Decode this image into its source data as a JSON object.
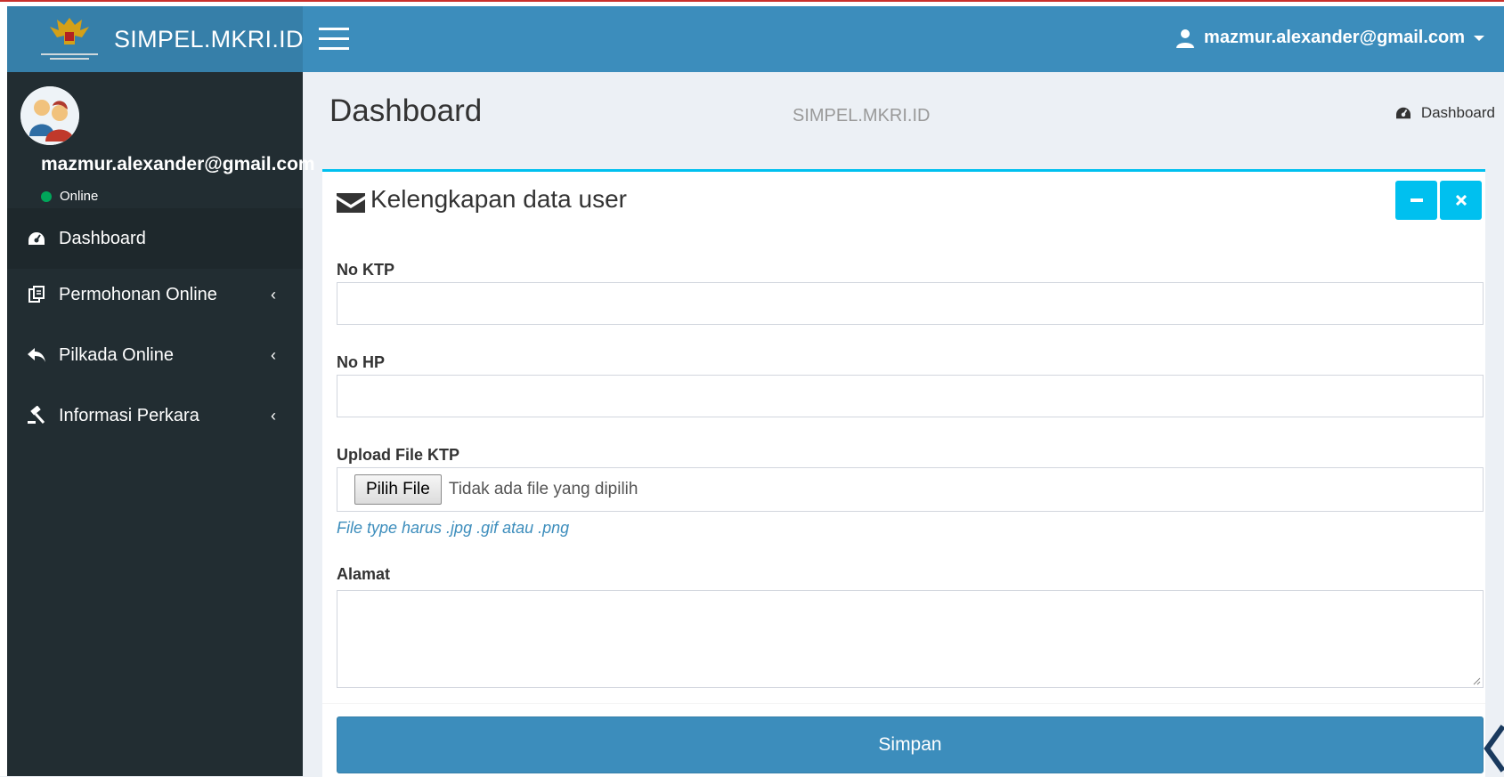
{
  "app": {
    "title": "SIMPEL.MKRI.ID"
  },
  "header": {
    "user_email": "mazmur.alexander@gmail.com"
  },
  "sidebar": {
    "user_name": "mazmur.alexander@gmail.com",
    "status": "Online",
    "items": [
      {
        "label": "Dashboard",
        "icon": "dashboard-icon",
        "active": true
      },
      {
        "label": "Permohonan Online",
        "icon": "clipboard-icon",
        "active": false
      },
      {
        "label": "Pilkada Online",
        "icon": "reply-icon",
        "active": false
      },
      {
        "label": "Informasi Perkara",
        "icon": "gavel-icon",
        "active": false
      }
    ]
  },
  "content": {
    "title": "Dashboard",
    "subtitle": "SIMPEL.MKRI.ID",
    "breadcrumb": "Dashboard"
  },
  "form": {
    "box_title": "Kelengkapan data user",
    "fields": {
      "ktp_label": "No KTP",
      "ktp_value": "",
      "hp_label": "No HP",
      "hp_value": "",
      "upload_label": "Upload File KTP",
      "file_button": "Pilih File",
      "file_status": "Tidak ada file yang dipilih",
      "file_help": "File type harus .jpg .gif atau .png",
      "alamat_label": "Alamat",
      "alamat_value": ""
    },
    "submit_label": "Simpan"
  },
  "colors": {
    "header": "#3c8dbc",
    "logo_bg": "#367fa9",
    "sidebar": "#222d32",
    "box_accent": "#00c0ef",
    "online": "#00a65a"
  }
}
